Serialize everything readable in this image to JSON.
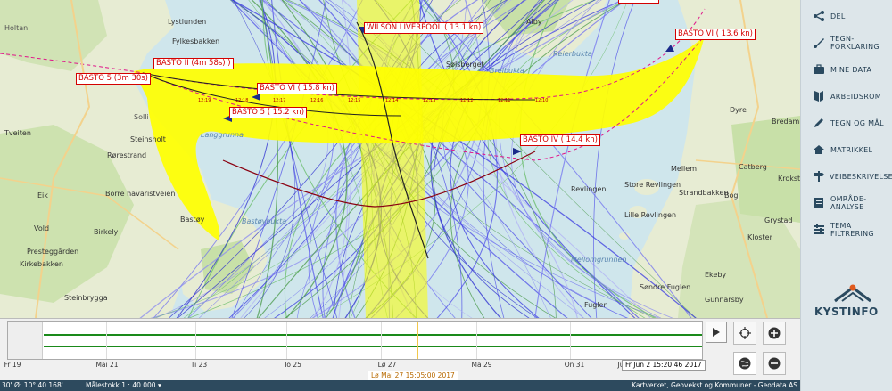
{
  "vessels": [
    {
      "label": "WILSON LIVERPOOL ( 13.1 kn)"
    },
    {
      "label": "BASTO II (4m 58s) )"
    },
    {
      "label": "BASTO 5 (3m 30s)"
    },
    {
      "label": "BASTO VI ( 15.8 kn)"
    },
    {
      "label": "BASTO 5 ( 15.2 kn)"
    },
    {
      "label": "BASTO IV ( 14.4 kn)"
    },
    {
      "label": "BASTO VI ( 13.6 kn)"
    }
  ],
  "timestamps_top": [
    "12:10",
    "12:11",
    "12:12",
    "12:13",
    "12:14",
    "12:15",
    "12:16",
    "12:17",
    "12:18",
    "12:19"
  ],
  "places": [
    {
      "name": "Holtan",
      "type": "town"
    },
    {
      "name": "Lystlunden",
      "type": "land"
    },
    {
      "name": "Fylkesbakken",
      "type": "land"
    },
    {
      "name": "Solli",
      "type": "town"
    },
    {
      "name": "Steinsholt",
      "type": "land"
    },
    {
      "name": "Langgrunna",
      "type": "water"
    },
    {
      "name": "Rørestrand",
      "type": "land"
    },
    {
      "name": "Borre havaristveien",
      "type": "land"
    },
    {
      "name": "Bastøy",
      "type": "land"
    },
    {
      "name": "Bastøybukta",
      "type": "water"
    },
    {
      "name": "Birkely",
      "type": "land"
    },
    {
      "name": "Vold",
      "type": "land"
    },
    {
      "name": "Eik",
      "type": "land"
    },
    {
      "name": "Tveiten",
      "type": "land"
    },
    {
      "name": "Presteggården",
      "type": "land"
    },
    {
      "name": "Kirkebakken",
      "type": "land"
    },
    {
      "name": "Steinbrygga",
      "type": "land"
    },
    {
      "name": "Sølsberget",
      "type": "land"
    },
    {
      "name": "Breibukta",
      "type": "water"
    },
    {
      "name": "Reierbukta",
      "type": "water"
    },
    {
      "name": "Alby",
      "type": "land"
    },
    {
      "name": "Revlingen",
      "type": "land"
    },
    {
      "name": "Store Revlingen",
      "type": "land"
    },
    {
      "name": "Lille Revlingen",
      "type": "land"
    },
    {
      "name": "Mellomgrunnen",
      "type": "water"
    },
    {
      "name": "Søndre Fuglen",
      "type": "land"
    },
    {
      "name": "Fuglen",
      "type": "land"
    },
    {
      "name": "Mellem",
      "type": "land"
    },
    {
      "name": "Strandbakken",
      "type": "land"
    },
    {
      "name": "Catberg",
      "type": "land"
    },
    {
      "name": "Bog",
      "type": "land"
    },
    {
      "name": "Grystad",
      "type": "land"
    },
    {
      "name": "Kloster",
      "type": "land"
    },
    {
      "name": "Ekeby",
      "type": "land"
    },
    {
      "name": "Gunnarsby",
      "type": "land"
    },
    {
      "name": "Dyre",
      "type": "land"
    },
    {
      "name": "Bredamn",
      "type": "land"
    },
    {
      "name": "Krokstad",
      "type": "land"
    }
  ],
  "sidebar": {
    "items": [
      {
        "icon": "share-icon",
        "label": "DEL"
      },
      {
        "icon": "legend-icon",
        "label": "TEGN-\nFORKLARING"
      },
      {
        "icon": "briefcase-icon",
        "label": "MINE DATA"
      },
      {
        "icon": "workspace-icon",
        "label": "ARBEIDSROM"
      },
      {
        "icon": "pencil-icon",
        "label": "TEGN OG MÅL"
      },
      {
        "icon": "cadastre-icon",
        "label": "MATRIKKEL"
      },
      {
        "icon": "signpost-icon",
        "label": "VEIBESKRIVELSE"
      },
      {
        "icon": "area-analysis-icon",
        "label": "OMRÅDE-\nANALYSE"
      },
      {
        "icon": "filter-icon",
        "label": "TEMA\nFILTRERING"
      }
    ],
    "logo_text": "KYSTINFO"
  },
  "timeline": {
    "ticks": [
      "Fr 19",
      "Mai 21",
      "Ti 23",
      "To 25",
      "Lø 27",
      "Ma 29",
      "On 31",
      "Ju"
    ],
    "current_time": "Lø Mai 27 15:05:00 2017",
    "end_time": "Fr Jun 2 15:20:46 2017"
  },
  "statusbar": {
    "coords": "30' Ø: 10° 40.168'",
    "scale": "Målestokk 1 : 40 000",
    "attribution": "Kartverket, Geovekst og Kommuner - Geodata AS"
  },
  "colors": {
    "water": "#cfe6ec",
    "land": "#e7ecd3",
    "forest": "#c8e0a8",
    "track_yellow": "#ffff00",
    "track_blue": "#2a2ad0",
    "vessel_red": "#d40000",
    "sidebar_bg": "#dde6ea"
  }
}
